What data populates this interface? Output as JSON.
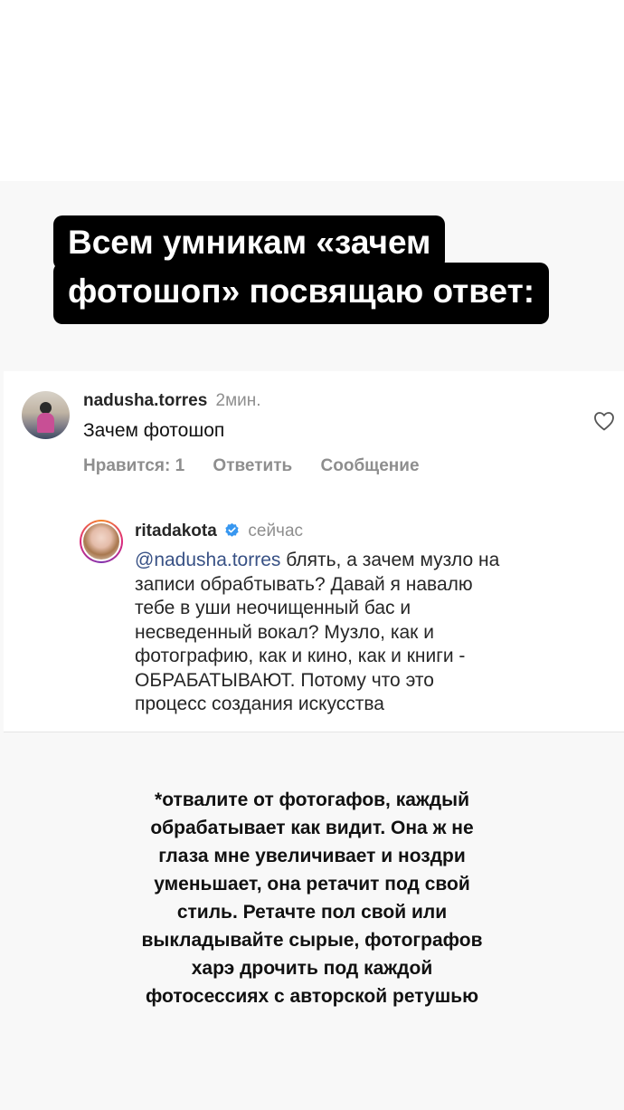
{
  "title": {
    "line1": "Всем умникам «зачем",
    "line2": "фотошоп» посвящаю ответ:"
  },
  "comment": {
    "username": "nadusha.torres",
    "time": "2мин.",
    "text": "Зачем фотошоп",
    "actions": {
      "likes": "Нравится: 1",
      "reply": "Ответить",
      "message": "Сообщение"
    },
    "heart_icon": "heart-outline-icon"
  },
  "reply": {
    "username": "ritadakota",
    "verified_icon": "verified-badge-icon",
    "time": "сейчас",
    "mention": "@nadusha.torres",
    "lines": [
      " блять, а зачем музло на",
      "записи обрабтывать? Давай я навалю",
      "тебе в уши неочищенный бас и",
      "несведенный вокал? Музло, как и",
      "фотографию, как и кино, как и книги -",
      "ОБРАБАТЫВАЮТ. Потому что это",
      "процесс создания искусства"
    ]
  },
  "note": {
    "lines": [
      "*отвалите от фотогафов, каждый",
      "обрабатывает как видит. Она ж не",
      "глаза мне увеличивает и ноздри",
      "уменьшает, она ретачит под свой",
      "стиль. Ретачте пол свой или",
      "выкладывайте сырые, фотографов",
      "харэ дрочить под каждой",
      "фотосессиях с авторской ретушью"
    ]
  },
  "colors": {
    "title_bg": "#000000",
    "mention": "#385185",
    "muted": "#8e8e8e",
    "verified": "#3897f0"
  }
}
